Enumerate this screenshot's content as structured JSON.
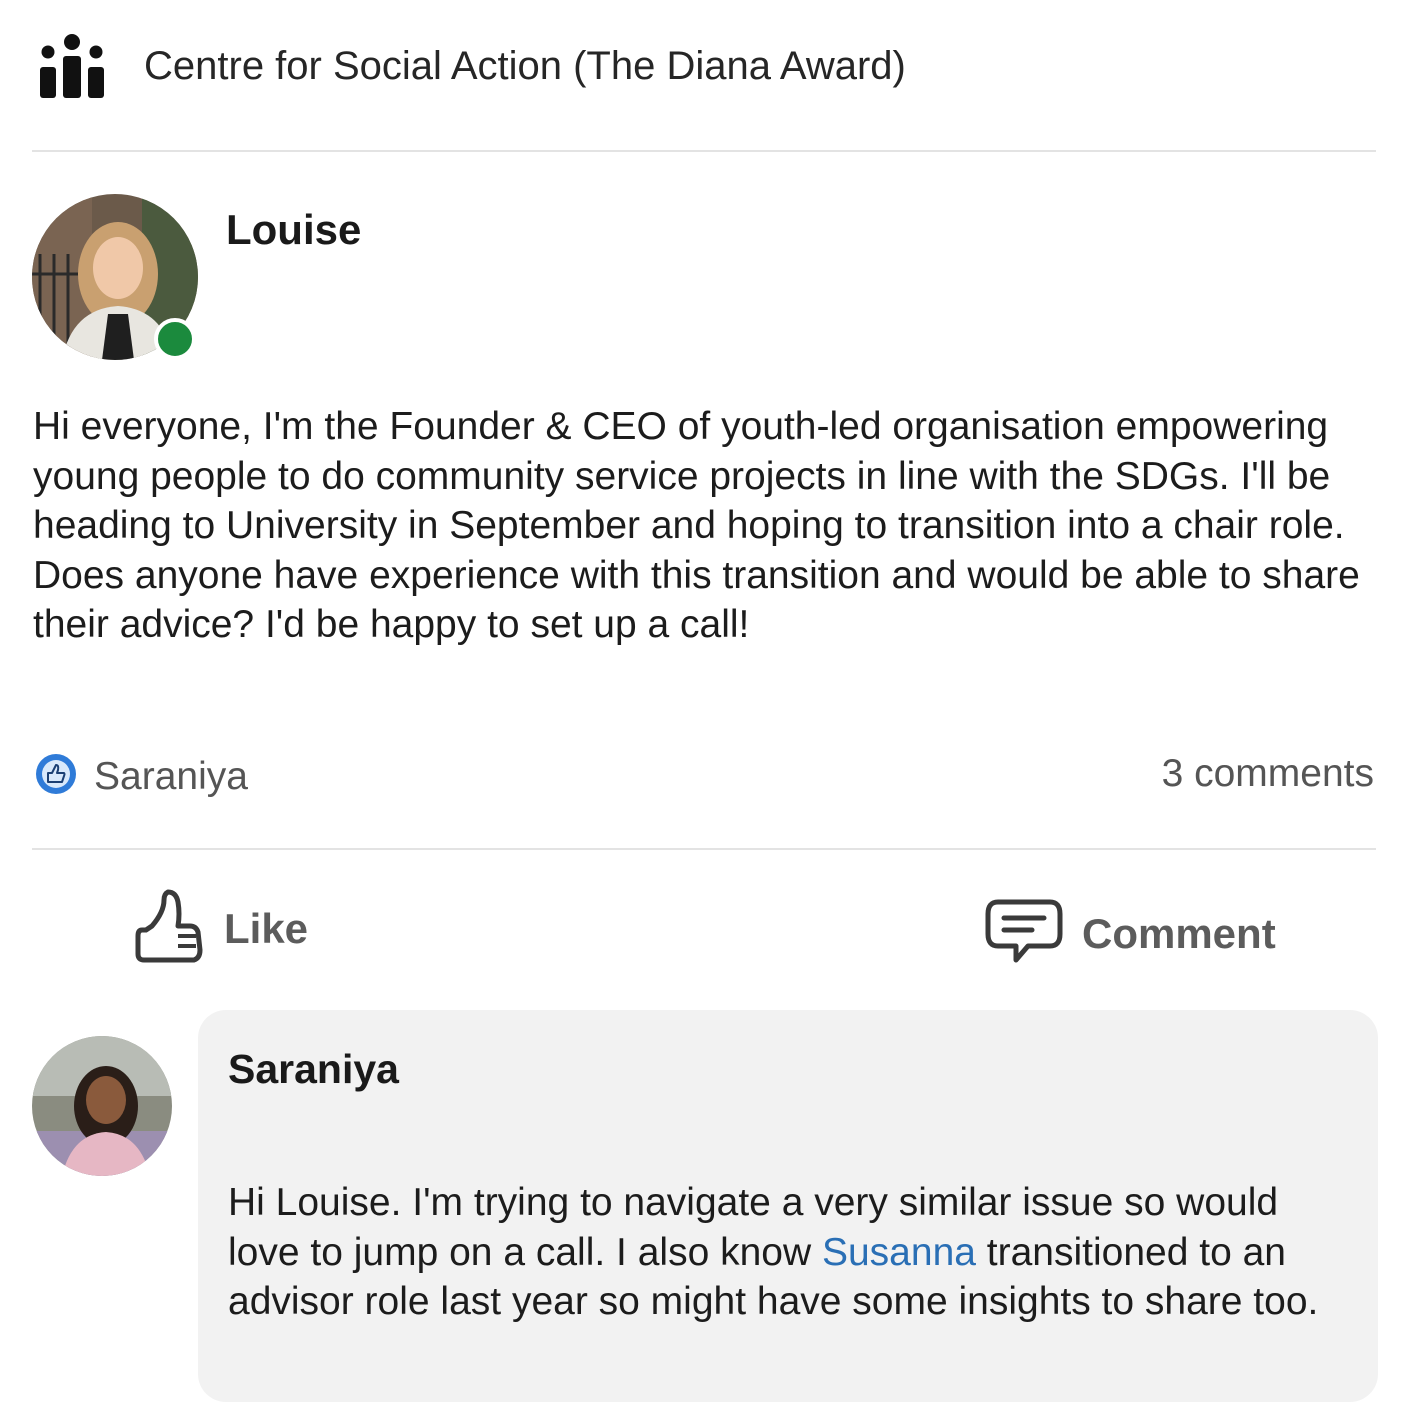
{
  "group": {
    "name": "Centre for Social Action (The Diana Award)",
    "icon": "group-people-icon"
  },
  "post": {
    "author": "Louise",
    "online_color": "#1b8a3d",
    "body": "Hi everyone, I'm the Founder & CEO of youth-led organisation empowering young people to do community service projects in line with the SDGs. I'll be heading to University in September and hoping to transition into a chair role. Does anyone have experience with this transition and would be able to share their advice? I'd be happy to set up a call!",
    "reactions": {
      "icon": "like-reaction-icon",
      "icon_color": "#2f7bd8",
      "reactor": "Saraniya"
    },
    "comment_count": "3 comments"
  },
  "actions": {
    "like_label": "Like",
    "comment_label": "Comment"
  },
  "comment": {
    "author": "Saraniya",
    "text_before": "Hi Louise. I'm trying to navigate a very similar issue so would love to jump on a call. I also know ",
    "mention": "Susanna",
    "text_after": " transitioned to an advisor role last year so might have some insights to share too.",
    "mention_color": "#2a6fb5"
  }
}
